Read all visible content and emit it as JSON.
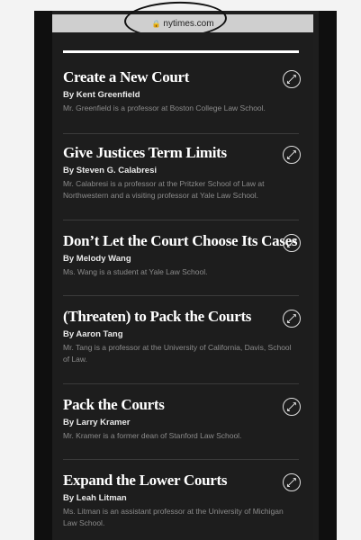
{
  "browser": {
    "url": "nytimes.com",
    "lock_icon": "lock-icon"
  },
  "articles": [
    {
      "title": "Create a New Court",
      "author": "By Kent Greenfield",
      "description": "Mr. Greenfield is a professor at Boston College Law School."
    },
    {
      "title": "Give Justices Term Limits",
      "author": "By Steven G. Calabresi",
      "description": "Mr. Calabresi is a professor at the Pritzker School of Law at Northwestern and a visiting professor at Yale Law School."
    },
    {
      "title": "Don’t Let the Court Choose Its Cases",
      "author": "By Melody Wang",
      "description": "Ms. Wang is a student at Yale Law School."
    },
    {
      "title": "(Threaten) to Pack the Courts",
      "author": "By Aaron Tang",
      "description": "Mr. Tang is a professor at the University of California, Davis, School of Law."
    },
    {
      "title": "Pack the Courts",
      "author": "By Larry Kramer",
      "description": "Mr. Kramer is a former dean of Stanford Law School."
    },
    {
      "title": "Expand the Lower Courts",
      "author": "By Leah Litman",
      "description": "Ms. Litman is an assistant professor at the University of Michigan Law School."
    }
  ],
  "icons": {
    "link": "link-icon"
  }
}
